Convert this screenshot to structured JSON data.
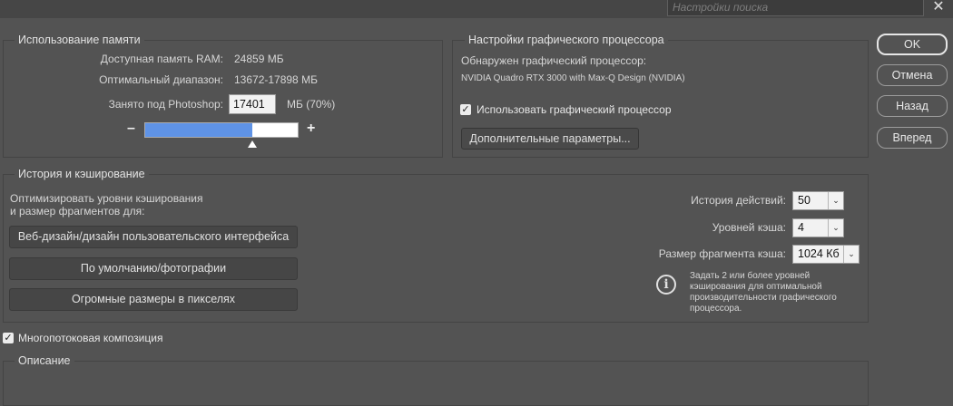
{
  "search": {
    "placeholder": "Настройки поиска"
  },
  "memory": {
    "title": "Использование памяти",
    "available_label": "Доступная память RAM:",
    "available_value": "24859 МБ",
    "optimal_label": "Оптимальный диапазон:",
    "optimal_value": "13672-17898 МБ",
    "used_label": "Занято под Photoshop:",
    "used_input": "17401",
    "used_unit": "МБ (70%)",
    "slider_fraction": 0.7,
    "minus": "–",
    "plus": "+"
  },
  "gpu": {
    "title": "Настройки графического процессора",
    "detected_label": "Обнаружен графический процессор:",
    "detected_name": "NVIDIA Quadro RTX 3000 with Max-Q Design (NVIDIA)",
    "use_gpu_label": "Использовать графический процессор",
    "use_gpu_checked": true,
    "advanced_button": "Дополнительные параметры..."
  },
  "dialog_buttons": {
    "ok": "OK",
    "cancel": "Отмена",
    "back": "Назад",
    "next": "Вперед"
  },
  "cache": {
    "title": "История и кэширование",
    "optimize_line1": "Оптимизировать уровни кэширования",
    "optimize_line2": "и размер фрагментов для:",
    "btn_web": "Веб-дизайн/дизайн пользовательского интерфейса",
    "btn_default": "По умолчанию/фотографии",
    "btn_huge": "Огромные размеры в пикселях",
    "history_label": "История действий:",
    "history_value": "50",
    "levels_label": "Уровней кэша:",
    "levels_value": "4",
    "tile_label": "Размер фрагмента кэша:",
    "tile_value": "1024 Кб",
    "info_text_1": "Задать 2 или более уровней",
    "info_text_2": "кэширования для оптимальной",
    "info_text_3": "производительности графического",
    "info_text_4": "процессора."
  },
  "multithread": {
    "label": "Многопотоковая композиция",
    "checked": true
  },
  "description": {
    "title": "Описание"
  }
}
